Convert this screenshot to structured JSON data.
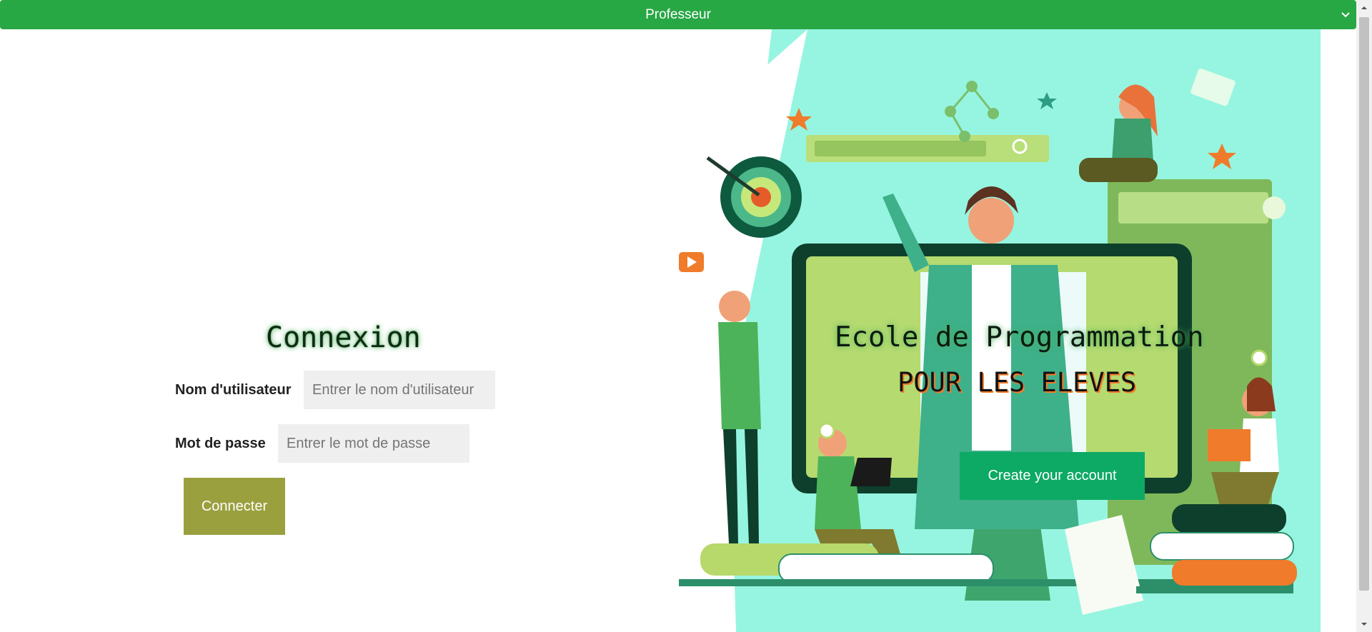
{
  "role_select": {
    "selected": "Professeur"
  },
  "login": {
    "title": "Connexion",
    "username_label": "Nom d'utilisateur",
    "username_placeholder": "Entrer le nom d'utilisateur",
    "password_label": "Mot de passe",
    "password_placeholder": "Entrer le mot de passe",
    "submit_label": "Connecter"
  },
  "hero": {
    "title": "Ecole de Programmation",
    "subtitle": "POUR LES ELEVES",
    "cta_label": "Create your account"
  },
  "colors": {
    "header_green": "#28a745",
    "connect_button": "#9aa03e",
    "create_button": "#0caa64",
    "hero_bg": "#96f5e0"
  }
}
